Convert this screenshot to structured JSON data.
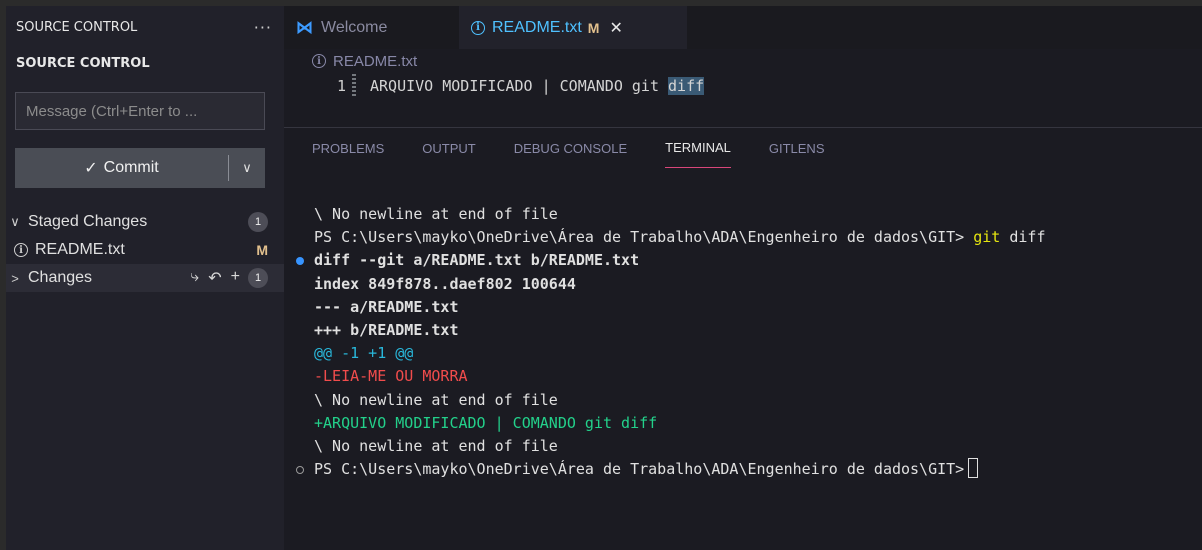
{
  "sidebar": {
    "header_title": "SOURCE CONTROL",
    "more_label": "···",
    "section_title": "SOURCE CONTROL",
    "message_placeholder": "Message (Ctrl+Enter to ...",
    "commit_label": "Commit",
    "commit_check": "✓",
    "dropdown_glyph": "∨",
    "staged": {
      "label": "Staged Changes",
      "count": "1",
      "chevron": "∨"
    },
    "staged_file": {
      "name": "README.txt",
      "status": "M"
    },
    "changes": {
      "label": "Changes",
      "count": "1",
      "chevron": ">"
    },
    "change_actions": [
      "⤷",
      "↶",
      "+"
    ]
  },
  "tabs": [
    {
      "label": "Welcome",
      "icon": "vscode-logo-icon"
    },
    {
      "label": "README.txt",
      "status": "M",
      "icon": "info-icon"
    }
  ],
  "editor": {
    "breadcrumb": "README.txt",
    "line_number": "1",
    "line_text_before": "ARQUIVO MODIFICADO | COMANDO git ",
    "line_text_highlight": "diff"
  },
  "panel": {
    "tabs": [
      "PROBLEMS",
      "OUTPUT",
      "DEBUG CONSOLE",
      "TERMINAL",
      "GITLENS"
    ],
    "active_tab": "TERMINAL"
  },
  "terminal": {
    "line1": "\\ No newline at end of file",
    "prompt_path": "PS C:\\Users\\mayko\\OneDrive\\Área de Trabalho\\ADA\\Engenheiro de dados\\GIT> ",
    "cmd_git": "git",
    "cmd_rest": " diff",
    "diff_header": "diff --git a/README.txt b/README.txt",
    "index_line": "index 849f878..daef802 100644",
    "minus_file": "--- a/README.txt",
    "plus_file": "+++ b/README.txt",
    "hunk": "@@ -1 +1 @@",
    "removed": "-LEIA-ME OU MORRA",
    "no_newline_1": "\\ No newline at end of file",
    "added": "+ARQUIVO MODIFICADO | COMANDO git diff",
    "no_newline_2": "\\ No newline at end of file",
    "final_prompt": "PS C:\\Users\\mayko\\OneDrive\\Área de Trabalho\\ADA\\Engenheiro de dados\\GIT>"
  },
  "colors": {
    "accent_tab": "#4fc1ff",
    "modified": "#e2c08d",
    "terminal_active_underline": "#d9467a",
    "diff_removed": "#f14c4c",
    "diff_added": "#23d18b"
  }
}
